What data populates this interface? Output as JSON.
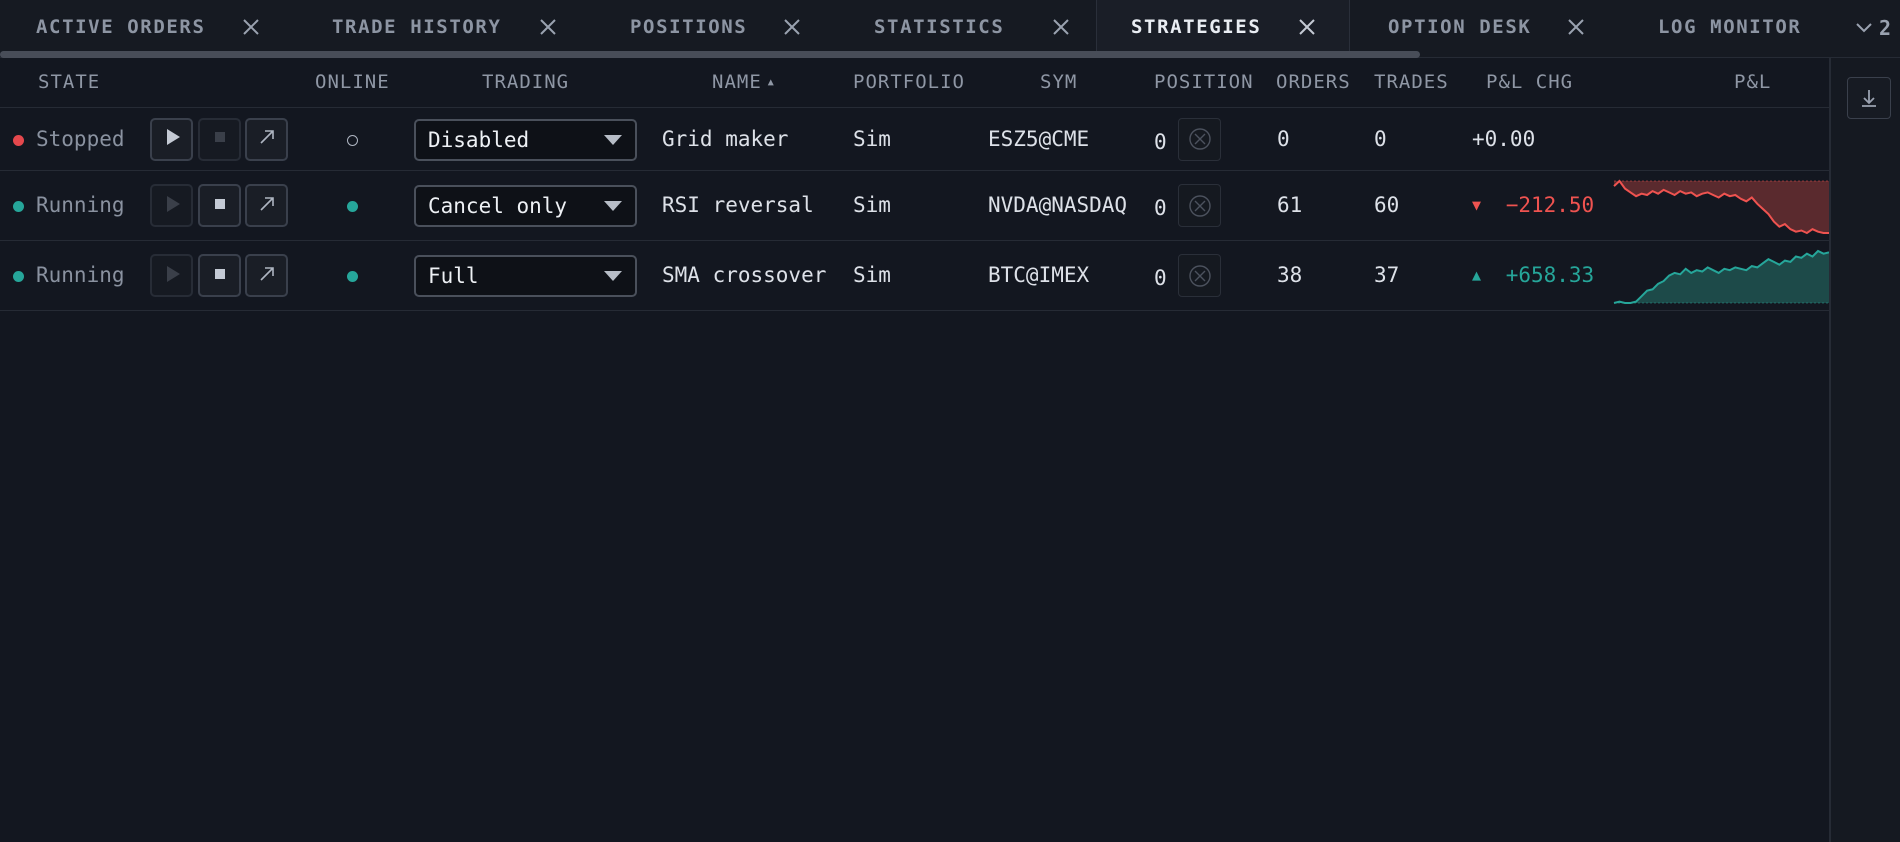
{
  "tabs": [
    {
      "label": "ACTIVE ORDERS",
      "active": false
    },
    {
      "label": "TRADE HISTORY",
      "active": false
    },
    {
      "label": "POSITIONS",
      "active": false
    },
    {
      "label": "STATISTICS",
      "active": false
    },
    {
      "label": "STRATEGIES",
      "active": true
    },
    {
      "label": "OPTION DESK",
      "active": false
    },
    {
      "label": "LOG MONITOR",
      "active": false
    }
  ],
  "tab_overflow_count": "2",
  "columns": {
    "state": "STATE",
    "online": "ONLINE",
    "trading": "TRADING",
    "name": "NAME",
    "portfolio": "PORTFOLIO",
    "sym": "SYM",
    "position": "POSITION",
    "orders": "ORDERS",
    "trades": "TRADES",
    "pnl_chg": "P&L CHG",
    "pnl": "P&L"
  },
  "sort_indicator": "▲",
  "rows": [
    {
      "state": "Stopped",
      "state_color": "#e5484d",
      "online": false,
      "trading": "Disabled",
      "name": "Grid maker",
      "portfolio": "Sim",
      "sym": "ESZ5@CME",
      "position": "0",
      "orders": "0",
      "trades": "0",
      "pnl_chg": "+0.00",
      "pnl_direction": "flat",
      "pnl_series": []
    },
    {
      "state": "Running",
      "state_color": "#26a69a",
      "online": true,
      "trading": "Cancel only",
      "name": "RSI reversal",
      "portfolio": "Sim",
      "sym": "NVDA@NASDAQ",
      "position": "0",
      "orders": "61",
      "trades": "60",
      "pnl_chg": "−212.50",
      "pnl_direction": "down",
      "pnl_series": [
        0,
        4,
        -2,
        -5,
        -8,
        -6,
        -7,
        -4,
        -6,
        -3,
        -5,
        -7,
        -4,
        -6,
        -5,
        -8,
        -6,
        -5,
        -7,
        -9,
        -6,
        -8,
        -7,
        -10,
        -12,
        -9,
        -14,
        -18,
        -22,
        -28,
        -32,
        -30,
        -34,
        -36,
        -35,
        -37,
        -34,
        -36,
        -37,
        -37
      ]
    },
    {
      "state": "Running",
      "state_color": "#26a69a",
      "online": true,
      "trading": "Full",
      "name": "SMA crossover",
      "portfolio": "Sim",
      "sym": "BTC@IMEX",
      "position": "0",
      "orders": "38",
      "trades": "37",
      "pnl_chg": "+658.33",
      "pnl_direction": "up",
      "pnl_series": [
        0,
        1,
        0,
        0,
        1,
        5,
        9,
        10,
        14,
        16,
        20,
        22,
        21,
        25,
        22,
        24,
        23,
        26,
        24,
        22,
        25,
        24,
        26,
        25,
        24,
        27,
        26,
        29,
        32,
        30,
        28,
        31,
        30,
        34,
        33,
        36,
        34,
        38,
        36,
        37
      ]
    }
  ],
  "colors": {
    "up": "#26a69a",
    "down": "#ef5350",
    "flat": "#dde1e8",
    "up_fill": "#1d4a49",
    "down_fill": "#5a2a2e"
  }
}
